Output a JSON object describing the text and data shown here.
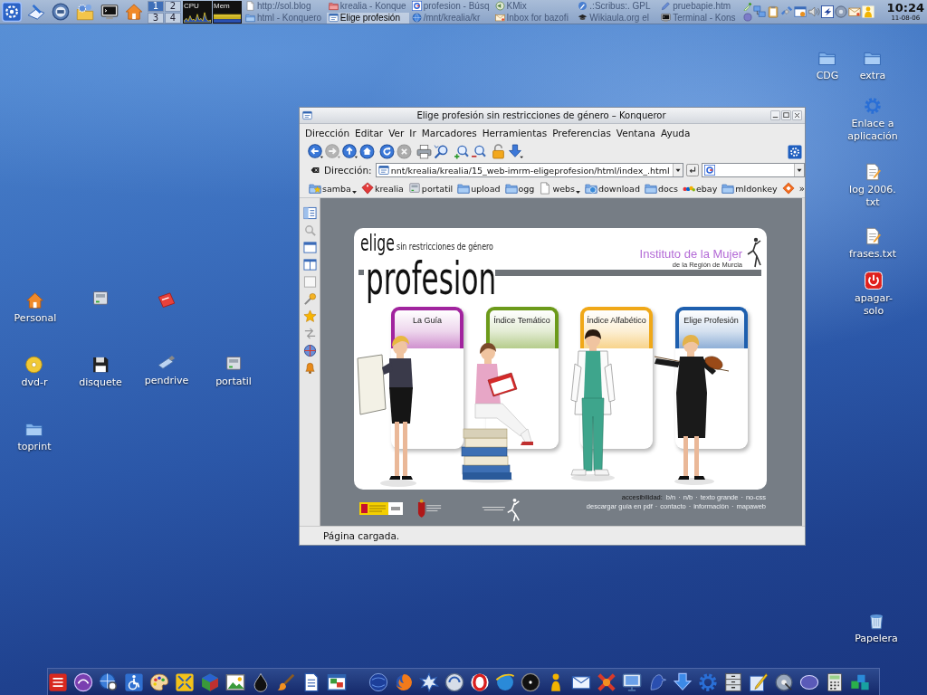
{
  "top_panel": {
    "pager": [
      {
        "label": "1",
        "selected": true
      },
      {
        "label": "2",
        "selected": false
      },
      {
        "label": "3",
        "selected": false
      },
      {
        "label": "4",
        "selected": false
      }
    ],
    "monitors": [
      {
        "label": "CPU"
      },
      {
        "label": "Mem"
      }
    ],
    "tasks": [
      {
        "label": "http://sol.blog",
        "selected": false
      },
      {
        "label": "krealia - Konque",
        "selected": false
      },
      {
        "label": "profesion - Búsq",
        "selected": false
      },
      {
        "label": "KMix",
        "selected": false
      },
      {
        "label": ".:Scribus:. GPL",
        "selected": false
      },
      {
        "label": "pruebapie.htm",
        "selected": false
      },
      {
        "label": "html - Konquero",
        "selected": false
      },
      {
        "label": "Elige profesión",
        "selected": true
      },
      {
        "label": "/mnt/krealia/kr",
        "selected": false
      },
      {
        "label": "Inbox for bazofi",
        "selected": false
      },
      {
        "label": "Wikiaula.org el",
        "selected": false
      },
      {
        "label": "Terminal - Kons",
        "selected": false
      }
    ],
    "clock": {
      "time": "10:24",
      "date": "11-08-06"
    }
  },
  "desktop": {
    "left_icons": [
      {
        "label": "Personal"
      },
      {
        "label": "dvd-r"
      },
      {
        "label": "disquete"
      },
      {
        "label": "pendrive"
      },
      {
        "label": "portatil"
      },
      {
        "label": "toprint"
      }
    ],
    "right_icons": [
      {
        "label": "CDG"
      },
      {
        "label": "extra"
      },
      {
        "label": "Enlace a aplicación"
      },
      {
        "label": "log 2006. txt"
      },
      {
        "label": "frases.txt"
      },
      {
        "label": "apagar-solo"
      },
      {
        "label": "Papelera"
      }
    ]
  },
  "window": {
    "title": "Elige profesión sin restricciones de género – Konqueror",
    "menu": [
      "Dirección",
      "Editar",
      "Ver",
      "Ir",
      "Marcadores",
      "Herramientas",
      "Preferencias",
      "Ventana",
      "Ayuda"
    ],
    "toolbar": [
      {
        "disabled": false
      },
      {
        "disabled": true
      },
      {
        "disabled": false
      },
      {
        "disabled": false
      },
      {
        "disabled": false
      },
      {
        "disabled": true
      },
      {
        "disabled": false
      },
      {
        "disabled": false
      },
      {
        "disabled": false
      },
      {
        "disabled": false
      },
      {
        "disabled": false
      },
      {
        "disabled": false
      }
    ],
    "location": {
      "label": "Dirección:",
      "url": "nnt/krealia/krealia/15_web-imrm-eligeprofesion/html/index_.html"
    },
    "bookmarks": {
      "items": [
        {
          "label": "samba",
          "submenu": true
        },
        {
          "label": "krealia",
          "submenu": false
        },
        {
          "label": "portatil",
          "submenu": false
        },
        {
          "label": "upload",
          "submenu": false
        },
        {
          "label": "ogg",
          "submenu": false
        },
        {
          "label": "webs",
          "submenu": true
        },
        {
          "label": "download",
          "submenu": false
        },
        {
          "label": "docs",
          "submenu": false
        },
        {
          "label": "ebay",
          "submenu": false
        },
        {
          "label": "mldonkey",
          "submenu": false
        }
      ],
      "overflow": "»"
    },
    "page": {
      "logo_top": "elige",
      "tagline": "sin restricciones de género",
      "logo_main": "profesion",
      "institute": "Instituto de la Mujer",
      "institute_sub": "de la Región de Murcia",
      "sections": [
        {
          "label": "La Guía",
          "color": "#a1249e"
        },
        {
          "label": "Índice Temático",
          "color": "#6c9a1a"
        },
        {
          "label": "Índice Alfabético",
          "color": "#f0a818"
        },
        {
          "label": "Elige Profesión",
          "color": "#1e5fae"
        }
      ],
      "footer": {
        "accessibility_label": "accesibilidad:",
        "accessibility_links": [
          "b/n",
          "n/b",
          "texto grande",
          "no-css"
        ],
        "links": [
          "descargar guía en pdf",
          "contacto",
          "información",
          "mapaweb"
        ],
        "separator": "·"
      }
    },
    "status": "Página cargada."
  }
}
